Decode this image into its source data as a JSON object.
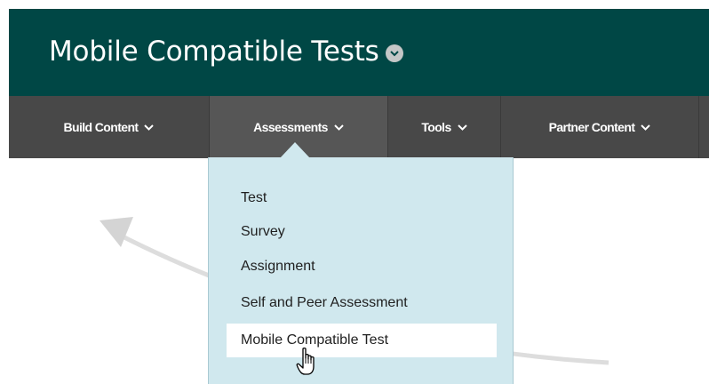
{
  "header": {
    "title": "Mobile Compatible Tests"
  },
  "nav": {
    "items": [
      {
        "label": "Build Content"
      },
      {
        "label": "Assessments"
      },
      {
        "label": "Tools"
      },
      {
        "label": "Partner Content"
      }
    ]
  },
  "dropdown": {
    "items": [
      {
        "label": "Test"
      },
      {
        "label": "Survey"
      },
      {
        "label": "Assignment"
      },
      {
        "label": "Self and Peer Assessment"
      },
      {
        "label": "Mobile Compatible Test"
      }
    ],
    "highlighted_index": 4
  },
  "icons": {
    "title_menu": "chevron-down-circle-icon",
    "nav_chevron": "chevron-down-icon",
    "cursor": "hand-pointer-icon",
    "background": "curved-arrow-icon"
  },
  "colors": {
    "header_bg": "#004745",
    "nav_bg": "#484848",
    "dropdown_bg": "#d0e8ee",
    "highlight_bg": "#ffffff"
  }
}
